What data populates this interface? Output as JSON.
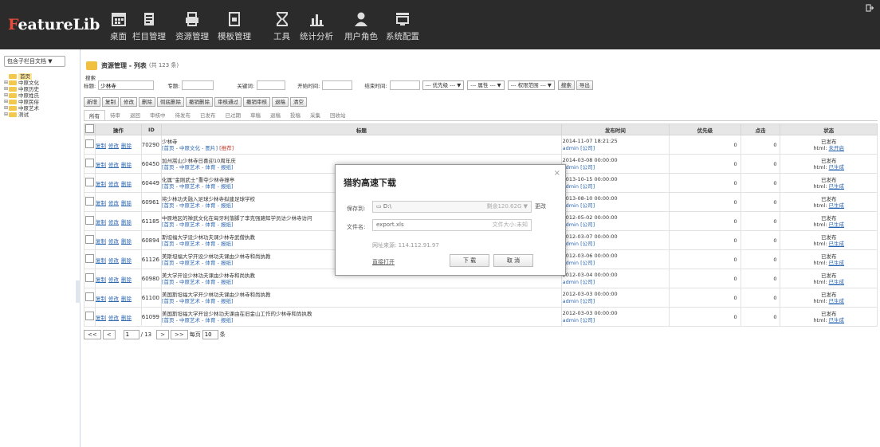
{
  "app": {
    "logo_first": "F",
    "logo_rest": "eatureLib"
  },
  "nav": [
    {
      "label": "桌面",
      "icon": "calendar-icon"
    },
    {
      "label": "栏目管理",
      "icon": "document-icon"
    },
    {
      "label": "资源管理",
      "icon": "printer-icon"
    },
    {
      "label": "模板管理",
      "icon": "template-icon"
    },
    {
      "label": "工具",
      "icon": "hourglass-icon"
    },
    {
      "label": "统计分析",
      "icon": "bar-chart-icon"
    },
    {
      "label": "用户角色",
      "icon": "user-icon"
    },
    {
      "label": "系统配置",
      "icon": "monitor-icon"
    }
  ],
  "sidebar": {
    "select": "包含子栏目文档",
    "tree": [
      {
        "label": "首页",
        "root": true,
        "prefix": ""
      },
      {
        "label": "中原文化",
        "prefix": "⊞"
      },
      {
        "label": "中原历史",
        "prefix": "⊞"
      },
      {
        "label": "中原姓氏",
        "prefix": "⊞"
      },
      {
        "label": "中原民俗",
        "prefix": "⊞"
      },
      {
        "label": "中原艺术",
        "prefix": "⊞"
      },
      {
        "label": "测试",
        "prefix": "⊞"
      }
    ]
  },
  "header": {
    "title": "资源管理 - 列表",
    "count": "(共 123 条)"
  },
  "search": {
    "caption": "搜索",
    "title_label": "标题:",
    "title_value": "少林寺",
    "tag_label": "专题:",
    "keyword_label": "关键词:",
    "start_label": "开始时间:",
    "end_label": "结束时间:",
    "priority": "--- 优先级 --- ▼",
    "attribute": "--- 属性 --- ▼",
    "scope": "--- 权限范围 --- ▼",
    "search_btn": "搜索",
    "export_btn": "导出"
  },
  "actions": [
    "新增",
    "复制",
    "修改",
    "删除",
    "彻底删除",
    "撤销删除",
    "审核通过",
    "撤销审核",
    "退稿",
    "清空"
  ],
  "tabs": [
    "所有",
    "待审",
    "退回",
    "审核中",
    "待发布",
    "已发布",
    "已过期",
    "草稿",
    "退稿",
    "投稿",
    "采集",
    "回收站"
  ],
  "table": {
    "headers": [
      "",
      "操作",
      "ID",
      "标题",
      "发布时间",
      "优先级",
      "点击",
      "状态"
    ],
    "ops": [
      "复制",
      "修改",
      "删除"
    ],
    "rows": [
      {
        "id": "70290",
        "title": "少林寺",
        "crumb": "[首页 - 中原文化 - 图片]",
        "tag": "[推荐]",
        "date": "2014-11-07 18:21:25",
        "author": "admin",
        "org": "[公司]",
        "priority": "0",
        "clicks": "0",
        "status": "已发布",
        "html_label": "html:",
        "html_status": "未开启"
      },
      {
        "id": "60450",
        "title": "加州嵩山少林寺日喜迎10周年庆",
        "crumb": "[首页 - 中原艺术 - 体育 - 报纸]",
        "tag": "",
        "date": "2014-03-08 00:00:00",
        "author": "admin",
        "org": "[公司]",
        "priority": "0",
        "clicks": "0",
        "status": "已发布",
        "html_label": "html:",
        "html_status": "已生成"
      },
      {
        "id": "60449",
        "title": "化属“金刚武士”重夺少林寺撞亭",
        "crumb": "[首页 - 中原艺术 - 体育 - 报纸]",
        "tag": "",
        "date": "2013-10-15 00:00:00",
        "author": "admin",
        "org": "[公司]",
        "priority": "0",
        "clicks": "0",
        "status": "已发布",
        "html_label": "html:",
        "html_status": "已生成"
      },
      {
        "id": "60961",
        "title": "将少林功夫融入足球少林寺拟建足球学校",
        "crumb": "[首页 - 中原艺术 - 体育 - 报纸]",
        "tag": "",
        "date": "2013-08-10 00:00:00",
        "author": "admin",
        "org": "[公司]",
        "priority": "0",
        "clicks": "0",
        "status": "已发布",
        "html_label": "html:",
        "html_status": "已生成"
      },
      {
        "id": "61185",
        "title": "中原地区的禅武文化在匈牙利落脚了李克强路知学员访少林寺访问",
        "crumb": "[首页 - 中原艺术 - 体育 - 报纸]",
        "tag": "",
        "date": "2012-05-02 00:00:00",
        "author": "admin",
        "org": "[公司]",
        "priority": "0",
        "clicks": "0",
        "status": "已发布",
        "html_label": "html:",
        "html_status": "已生成"
      },
      {
        "id": "60894",
        "title": "斯坦福大学设少林功夫课少林寺武僧执教",
        "crumb": "[首页 - 中原艺术 - 体育 - 报纸]",
        "tag": "",
        "date": "2012-03-07 00:00:00",
        "author": "admin",
        "org": "[公司]",
        "priority": "0",
        "clicks": "0",
        "status": "已发布",
        "html_label": "html:",
        "html_status": "已生成"
      },
      {
        "id": "61126",
        "title": "美斯坦福大学开设少林功夫课由少林寺和尚执教",
        "crumb": "[首页 - 中原艺术 - 体育 - 报纸]",
        "tag": "",
        "date": "2012-03-06 00:00:00",
        "author": "admin",
        "org": "[公司]",
        "priority": "0",
        "clicks": "0",
        "status": "已发布",
        "html_label": "html:",
        "html_status": "已生成"
      },
      {
        "id": "60980",
        "title": "美大学开设少林功夫课由少林寺和尚执教",
        "crumb": "[首页 - 中原艺术 - 体育 - 报纸]",
        "tag": "",
        "date": "2012-03-04 00:00:00",
        "author": "admin",
        "org": "[公司]",
        "priority": "0",
        "clicks": "0",
        "status": "已发布",
        "html_label": "html:",
        "html_status": "已生成"
      },
      {
        "id": "61100",
        "title": "美国斯坦福大学开少林功夫课由少林寺和尚执教",
        "crumb": "[首页 - 中原艺术 - 体育 - 报纸]",
        "tag": "",
        "date": "2012-03-03 00:00:00",
        "author": "admin",
        "org": "[公司]",
        "priority": "0",
        "clicks": "0",
        "status": "已发布",
        "html_label": "html:",
        "html_status": "已生成"
      },
      {
        "id": "61099",
        "title": "美国斯坦福大学开设少林功夫课由在旧金山工作的少林寺和尚执教",
        "crumb": "[首页 - 中原艺术 - 体育 - 报纸]",
        "tag": "",
        "date": "2012-03-03 00:00:00",
        "author": "admin",
        "org": "[公司]",
        "priority": "0",
        "clicks": "0",
        "status": "已发布",
        "html_label": "html:",
        "html_status": "已生成"
      }
    ]
  },
  "pager": {
    "first": "<<",
    "prev": "<",
    "page": "1",
    "total": "/ 13",
    "next": ">",
    "last": ">>",
    "per_label": "每页",
    "per_value": "10",
    "unit": "条"
  },
  "dialog": {
    "title": "猎豹高速下载",
    "save_label": "保存到:",
    "save_path": "D:\\",
    "space": "剩余120.62G ▼",
    "browse": "更改",
    "name_label": "文件名:",
    "file_name": "export.xls",
    "size": "文件大小:未知",
    "source": "网址来源: 114.112.91.97",
    "open_dir": "直接打开",
    "download": "下 载",
    "cancel": "取 消",
    "close": "×"
  }
}
